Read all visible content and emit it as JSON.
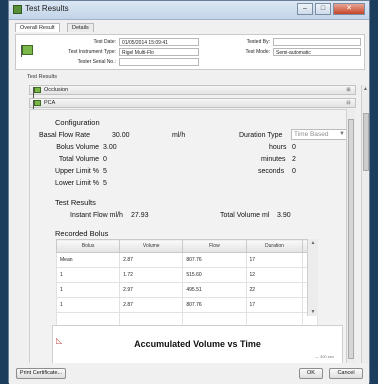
{
  "window": {
    "title": "Test Results"
  },
  "window_controls": {
    "minimize": "–",
    "maximize": "□",
    "close": "✕"
  },
  "tabs": [
    {
      "label": "Overall Result"
    },
    {
      "label": "Details"
    }
  ],
  "header": {
    "test_date_label": "Test Date:",
    "test_date_value": "01/05/2014 15:09:41",
    "tested_by_label": "Tested By:",
    "tested_by_value": "",
    "instrument_type_label": "Test Instrument Type:",
    "instrument_type_value": "Rigel Multi-Flo",
    "test_mode_label": "Test Mode:",
    "test_mode_value": "Semi-automatic",
    "serial_label": "Tester Serial No.:",
    "serial_value": ""
  },
  "test_results_label": "Test Results",
  "accordion": [
    {
      "label": "Occlusion",
      "toggle": "⊞"
    },
    {
      "label": "PCA",
      "toggle": "⊟"
    }
  ],
  "pca": {
    "configuration_title": "Configuration",
    "basal_flow_rate_label": "Basal Flow Rate",
    "basal_flow_rate_value": "30.00",
    "basal_flow_rate_unit": "ml/h",
    "duration_type_label": "Duration Type",
    "duration_type_value": "Time Based",
    "bolus_volume_label": "Bolus Volume",
    "bolus_volume_value": "3.00",
    "hours_label": "hours",
    "hours_value": "0",
    "total_volume_label": "Total Volume",
    "total_volume_value": "0",
    "minutes_label": "minutes",
    "minutes_value": "2",
    "upper_limit_label": "Upper Limit %",
    "upper_limit_value": "5",
    "seconds_label": "seconds",
    "seconds_value": "0",
    "lower_limit_label": "Lower Limit %",
    "lower_limit_value": "5",
    "test_results_title": "Test Results",
    "instant_flow_label": "Instant Flow ml/h",
    "instant_flow_value": "27.93",
    "total_volume_ml_label": "Total Volume ml",
    "total_volume_ml_value": "3.90",
    "recorded_bolus_title": "Recorded Bolus"
  },
  "bolus_table": {
    "columns": [
      "Bolus",
      "Volume",
      "Flow",
      "Duration"
    ],
    "rows": [
      [
        "Mean",
        "2.87",
        "807.76",
        "17"
      ],
      [
        "1",
        "1.72",
        "515.60",
        "12"
      ],
      [
        "1",
        "2.97",
        "495.51",
        "22"
      ],
      [
        "1",
        "2.87",
        "807.76",
        "17"
      ]
    ]
  },
  "chart": {
    "title": "Accumulated Volume vs Time",
    "legend": "— 300 sec"
  },
  "footer": {
    "print_label": "Print Certificate...",
    "ok_label": "OK",
    "cancel_label": "Cancel"
  },
  "colors": {
    "flag_green": "#7ab648",
    "title_bar": "#c3d4e8",
    "close_red": "#c5452a",
    "desktop": "#1d3d5c"
  }
}
